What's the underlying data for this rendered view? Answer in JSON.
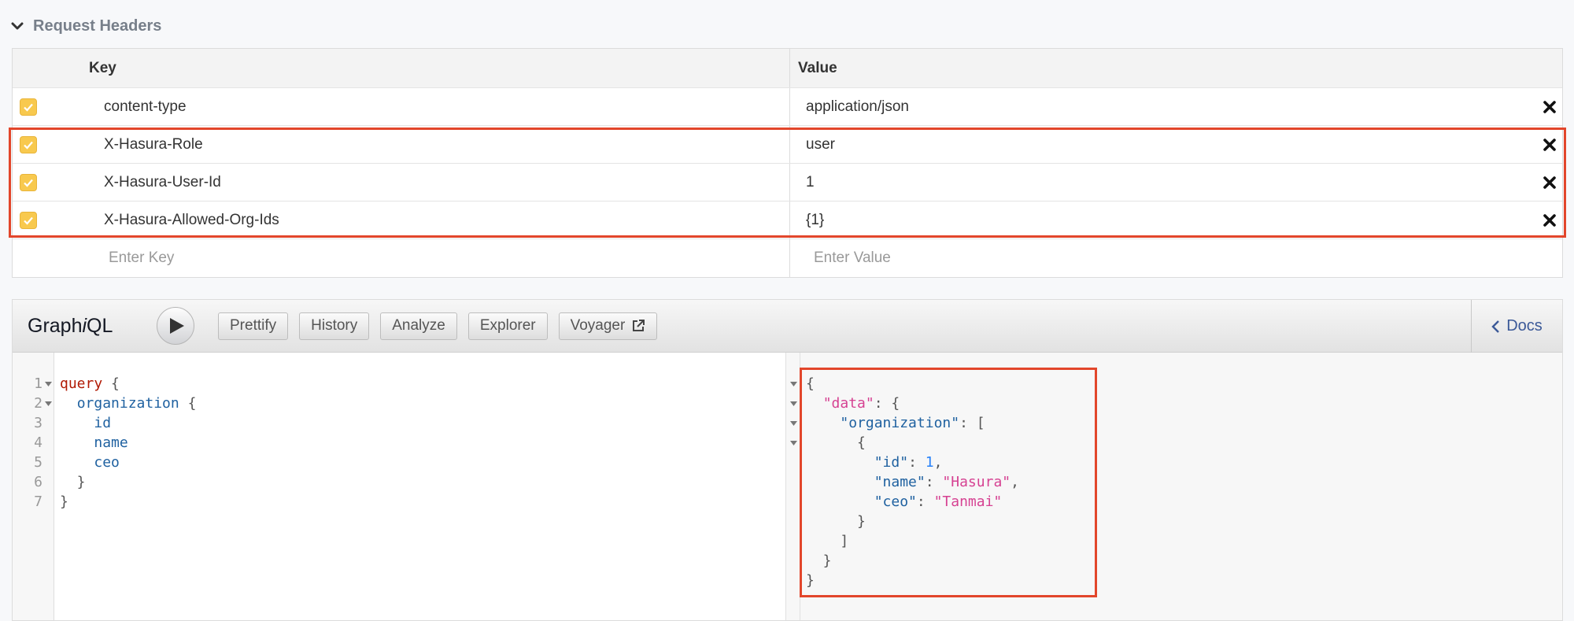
{
  "request_headers": {
    "title": "Request Headers",
    "columns": {
      "key": "Key",
      "value": "Value"
    },
    "rows": [
      {
        "key": "content-type",
        "value": "application/json",
        "checked": true
      },
      {
        "key": "X-Hasura-Role",
        "value": "user",
        "checked": true
      },
      {
        "key": "X-Hasura-User-Id",
        "value": "1",
        "checked": true
      },
      {
        "key": "X-Hasura-Allowed-Org-Ids",
        "value": "{1}",
        "checked": true
      }
    ],
    "new_row": {
      "key_placeholder": "Enter Key",
      "value_placeholder": "Enter Value"
    }
  },
  "graphiql": {
    "logo": {
      "prefix": "Graph",
      "italic": "i",
      "suffix": "QL"
    },
    "toolbar": {
      "prettify": "Prettify",
      "history": "History",
      "analyze": "Analyze",
      "explorer": "Explorer",
      "voyager": "Voyager",
      "docs": "Docs"
    },
    "query_lines": [
      "1",
      "2",
      "3",
      "4",
      "5",
      "6",
      "7"
    ],
    "query": {
      "kw_query": "query",
      "field_organization": "organization",
      "field_id": "id",
      "field_name": "name",
      "field_ceo": "ceo"
    },
    "result": {
      "key_data": "\"data\"",
      "key_organization": "\"organization\"",
      "key_id": "\"id\"",
      "val_id": "1",
      "key_name": "\"name\"",
      "val_name": "\"Hasura\"",
      "key_ceo": "\"ceo\"",
      "val_ceo": "\"Tanmai\""
    }
  },
  "colors": {
    "accent_checkbox": "#f8c94e",
    "highlight_box": "#e2462b",
    "keyword": "#b11a04",
    "field": "#1f61a0",
    "string": "#d64292",
    "number": "#2882f9"
  }
}
